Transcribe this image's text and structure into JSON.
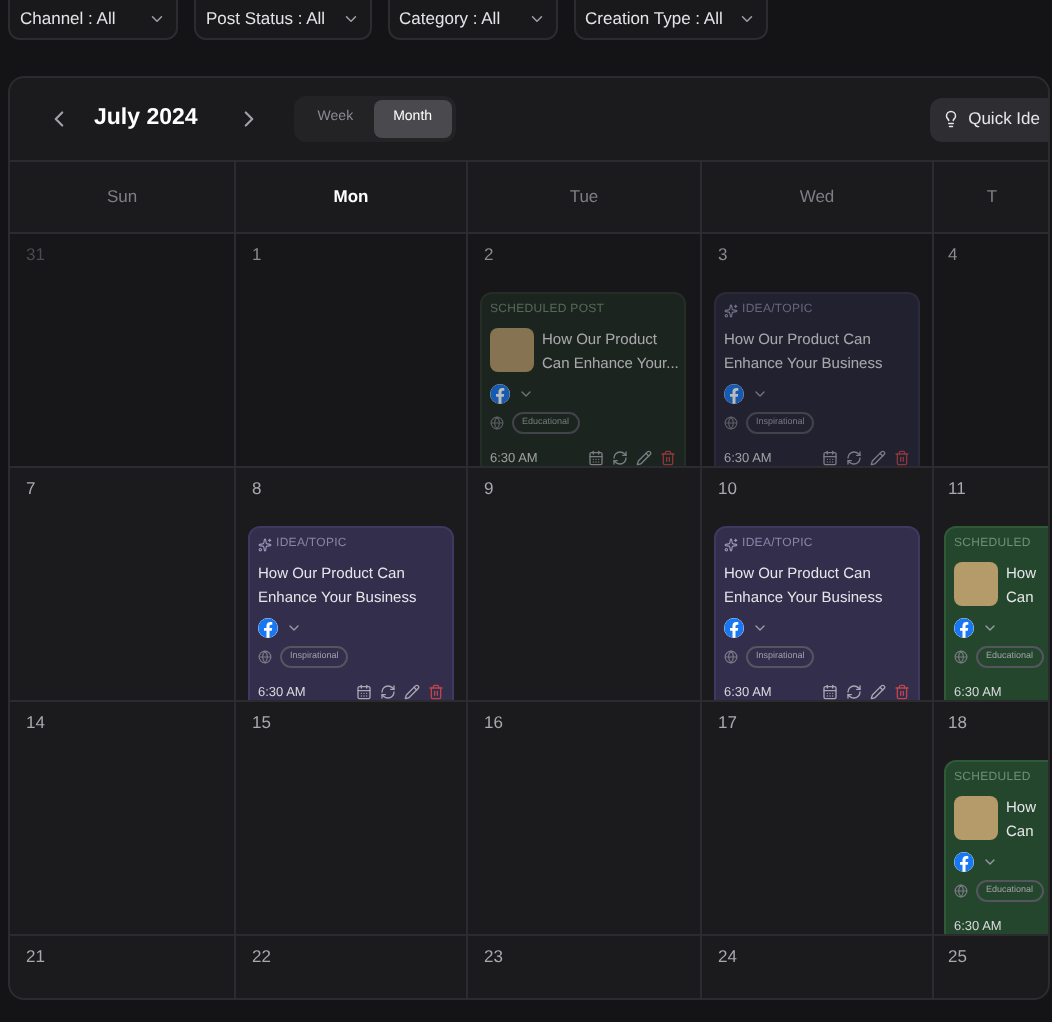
{
  "filters": [
    {
      "label": "Channel : All"
    },
    {
      "label": "Post Status : All"
    },
    {
      "label": "Category : All"
    },
    {
      "label": "Creation Type : All"
    }
  ],
  "calendar": {
    "month": "July 2024",
    "views": [
      {
        "label": "Week",
        "selected": false
      },
      {
        "label": "Month",
        "selected": true
      }
    ],
    "quick_idea": "Quick Ide",
    "weekdays": [
      {
        "label": "Sun",
        "current": false
      },
      {
        "label": "Mon",
        "current": true
      },
      {
        "label": "Tue",
        "current": false
      },
      {
        "label": "Wed",
        "current": false
      },
      {
        "label": "T",
        "current": false
      }
    ],
    "weeks": [
      {
        "past": true,
        "days": [
          {
            "date": "31",
            "outside": true
          },
          {
            "date": "1",
            "outside": false
          },
          {
            "date": "2",
            "outside": false,
            "posts": [
              {
                "kind": "scheduled",
                "label": "SCHEDULED POST",
                "title_lines": [
                  "How Our Product",
                  "Can Enhance Your..."
                ],
                "tag": "Educational",
                "time": "6:30 AM"
              }
            ]
          },
          {
            "date": "3",
            "outside": false,
            "posts": [
              {
                "kind": "idea",
                "label": "IDEA/TOPIC",
                "title_lines": [
                  "How Our Product Can",
                  "Enhance Your Business"
                ],
                "tag": "Inspirational",
                "time": "6:30 AM"
              }
            ]
          },
          {
            "date": "4",
            "outside": false
          }
        ]
      },
      {
        "past": false,
        "days": [
          {
            "date": "7",
            "outside": false
          },
          {
            "date": "8",
            "outside": false,
            "posts": [
              {
                "kind": "idea",
                "label": "IDEA/TOPIC",
                "title_lines": [
                  "How Our Product Can",
                  "Enhance Your Business"
                ],
                "tag": "Inspirational",
                "time": "6:30 AM"
              }
            ]
          },
          {
            "date": "9",
            "outside": false
          },
          {
            "date": "10",
            "outside": false,
            "posts": [
              {
                "kind": "idea",
                "label": "IDEA/TOPIC",
                "title_lines": [
                  "How Our Product Can",
                  "Enhance Your Business"
                ],
                "tag": "Inspirational",
                "time": "6:30 AM"
              }
            ]
          },
          {
            "date": "11",
            "outside": false,
            "posts": [
              {
                "kind": "scheduled",
                "label": "SCHEDULED",
                "title_lines": [
                  "How",
                  "Can"
                ],
                "tag": "Educational",
                "time": "6:30 AM"
              }
            ]
          }
        ]
      },
      {
        "past": false,
        "days": [
          {
            "date": "14",
            "outside": false
          },
          {
            "date": "15",
            "outside": false
          },
          {
            "date": "16",
            "outside": false
          },
          {
            "date": "17",
            "outside": false
          },
          {
            "date": "18",
            "outside": false,
            "posts": [
              {
                "kind": "scheduled",
                "label": "SCHEDULED",
                "title_lines": [
                  "How",
                  "Can"
                ],
                "tag": "Educational",
                "time": "6:30 AM"
              }
            ]
          }
        ]
      },
      {
        "past": false,
        "days": [
          {
            "date": "21",
            "outside": false
          },
          {
            "date": "22",
            "outside": false
          },
          {
            "date": "23",
            "outside": false
          },
          {
            "date": "24",
            "outside": false
          },
          {
            "date": "25",
            "outside": false
          }
        ]
      }
    ]
  }
}
